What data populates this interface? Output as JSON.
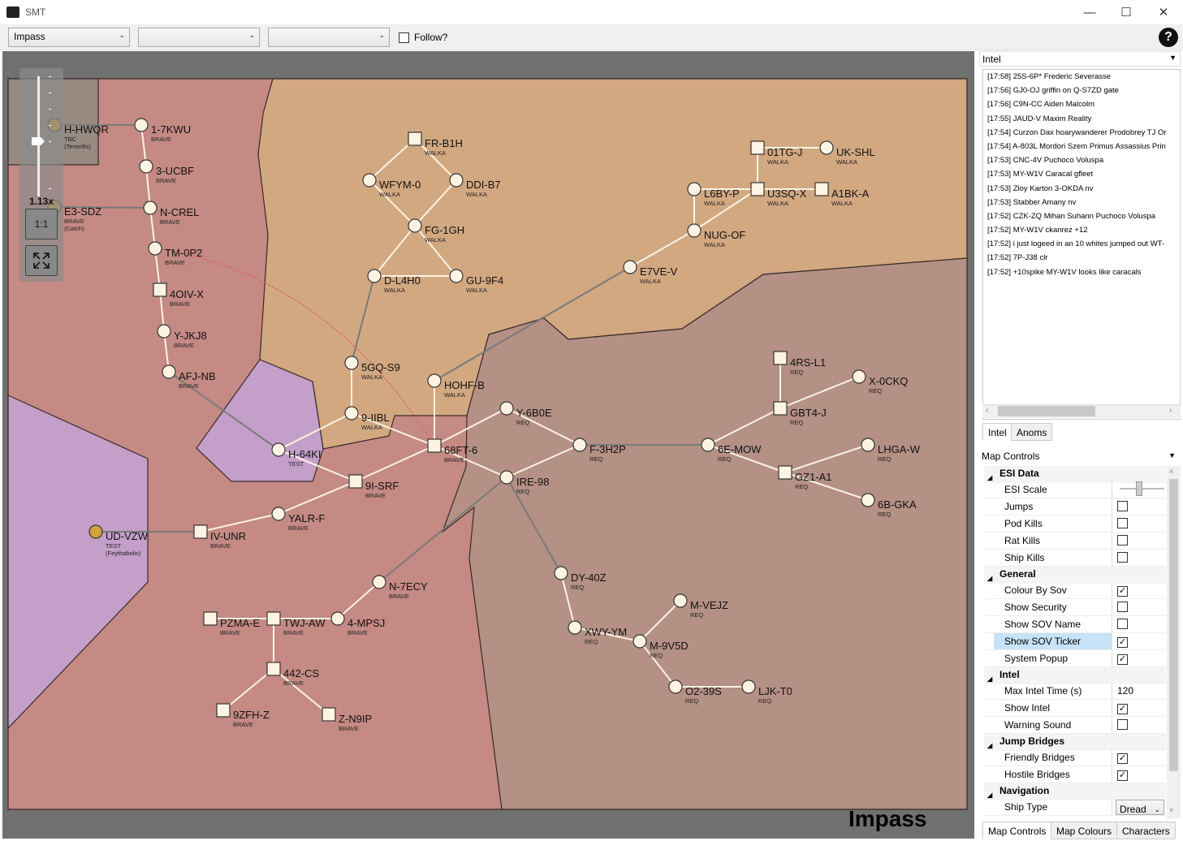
{
  "window": {
    "title": "SMT"
  },
  "toolbar": {
    "region_select": "Impass",
    "select_2": "",
    "select_3": "",
    "follow_label": "Follow?",
    "follow_checked": false,
    "help_label": "?"
  },
  "map": {
    "region_name": "Impass",
    "zoom_label": "1.13x",
    "reset_zoom_label": "1:1",
    "colors": {
      "brave": "#c48a83",
      "walka": "#d2a881",
      "req": "#b49085",
      "test": "#c49fc9",
      "tbc": "#978a81",
      "border": "#3a2a2a",
      "node_fill": "#fdf3e3",
      "jb_line": "#e06060"
    },
    "systems": [
      {
        "name": "H-HWQR",
        "sov": "TBC",
        "sub": "(Tenerifis)",
        "shape": "circle",
        "highlight": true
      },
      {
        "name": "1-7KWU",
        "sov": "BRAVE",
        "shape": "circle"
      },
      {
        "name": "3-UCBF",
        "sov": "BRAVE",
        "shape": "circle"
      },
      {
        "name": "E3-SDZ",
        "sov": "BRAVE",
        "sub": "(Catch)",
        "shape": "circle",
        "highlight": true
      },
      {
        "name": "N-CREL",
        "sov": "BRAVE",
        "shape": "circle"
      },
      {
        "name": "TM-0P2",
        "sov": "BRAVE",
        "shape": "circle"
      },
      {
        "name": "4OIV-X",
        "sov": "BRAVE",
        "shape": "square"
      },
      {
        "name": "Y-JKJ8",
        "sov": "BRAVE",
        "shape": "circle"
      },
      {
        "name": "AFJ-NB",
        "sov": "BRAVE",
        "shape": "circle"
      },
      {
        "name": "H-64KI",
        "sov": "TEST",
        "shape": "circle"
      },
      {
        "name": "FR-B1H",
        "sov": "WALKA",
        "shape": "square"
      },
      {
        "name": "WFYM-0",
        "sov": "WALKA",
        "shape": "circle"
      },
      {
        "name": "DDI-B7",
        "sov": "WALKA",
        "shape": "circle"
      },
      {
        "name": "FG-1GH",
        "sov": "WALKA",
        "shape": "circle"
      },
      {
        "name": "D-L4H0",
        "sov": "WALKA",
        "shape": "circle"
      },
      {
        "name": "GU-9F4",
        "sov": "WALKA",
        "shape": "circle"
      },
      {
        "name": "5GQ-S9",
        "sov": "WALKA",
        "shape": "circle"
      },
      {
        "name": "9-IIBL",
        "sov": "WALKA",
        "shape": "circle"
      },
      {
        "name": "HOHF-B",
        "sov": "WALKA",
        "shape": "circle"
      },
      {
        "name": "68FT-6",
        "sov": "BRAVE",
        "shape": "square"
      },
      {
        "name": "9I-SRF",
        "sov": "BRAVE",
        "shape": "square"
      },
      {
        "name": "YALR-F",
        "sov": "BRAVE",
        "shape": "circle"
      },
      {
        "name": "IV-UNR",
        "sov": "BRAVE",
        "shape": "square"
      },
      {
        "name": "UD-VZW",
        "sov": "TEST",
        "sub": "(Feythabolis)",
        "shape": "circle",
        "highlight": true
      },
      {
        "name": "N-7ECY",
        "sov": "BRAVE",
        "shape": "circle"
      },
      {
        "name": "4-MPSJ",
        "sov": "BRAVE",
        "shape": "circle"
      },
      {
        "name": "TWJ-AW",
        "sov": "BRAVE",
        "shape": "square"
      },
      {
        "name": "PZMA-E",
        "sov": "BRAVE",
        "shape": "square"
      },
      {
        "name": "442-CS",
        "sov": "BRAVE",
        "shape": "square"
      },
      {
        "name": "9ZFH-Z",
        "sov": "BRAVE",
        "shape": "square"
      },
      {
        "name": "Z-N9IP",
        "sov": "BRAVE",
        "shape": "square"
      },
      {
        "name": "Y-6B0E",
        "sov": "REQ",
        "shape": "circle"
      },
      {
        "name": "F-3H2P",
        "sov": "REQ",
        "shape": "circle"
      },
      {
        "name": "IRE-98",
        "sov": "REQ",
        "shape": "circle"
      },
      {
        "name": "DY-40Z",
        "sov": "REQ",
        "shape": "circle"
      },
      {
        "name": "XWY-YM",
        "sov": "REQ",
        "shape": "circle"
      },
      {
        "name": "M-9V5D",
        "sov": "REQ",
        "shape": "circle"
      },
      {
        "name": "M-VEJZ",
        "sov": "REQ",
        "shape": "circle"
      },
      {
        "name": "O2-39S",
        "sov": "REQ",
        "shape": "circle"
      },
      {
        "name": "LJK-T0",
        "sov": "REQ",
        "shape": "circle"
      },
      {
        "name": "6E-MOW",
        "sov": "REQ",
        "shape": "circle"
      },
      {
        "name": "GZ1-A1",
        "sov": "REQ",
        "shape": "square"
      },
      {
        "name": "LHGA-W",
        "sov": "REQ",
        "shape": "circle"
      },
      {
        "name": "6B-GKA",
        "sov": "REQ",
        "shape": "circle"
      },
      {
        "name": "GBT4-J",
        "sov": "REQ",
        "shape": "square"
      },
      {
        "name": "4RS-L1",
        "sov": "REQ",
        "shape": "square"
      },
      {
        "name": "X-0CKQ",
        "sov": "REQ",
        "shape": "circle"
      },
      {
        "name": "E7VE-V",
        "sov": "WALKA",
        "shape": "circle"
      },
      {
        "name": "NUG-OF",
        "sov": "WALKA",
        "shape": "circle"
      },
      {
        "name": "L6BY-P",
        "sov": "WALKA",
        "shape": "circle"
      },
      {
        "name": "U3SQ-X",
        "sov": "WALKA",
        "shape": "square"
      },
      {
        "name": "A1BK-A",
        "sov": "WALKA",
        "shape": "square"
      },
      {
        "name": "01TG-J",
        "sov": "WALKA",
        "shape": "square"
      },
      {
        "name": "UK-SHL",
        "sov": "WALKA",
        "shape": "circle"
      }
    ],
    "jumps": [
      [
        "H-HWQR",
        "1-7KWU",
        "x"
      ],
      [
        "1-7KWU",
        "3-UCBF",
        ""
      ],
      [
        "3-UCBF",
        "N-CREL",
        ""
      ],
      [
        "E3-SDZ",
        "N-CREL",
        "x"
      ],
      [
        "N-CREL",
        "TM-0P2",
        ""
      ],
      [
        "TM-0P2",
        "4OIV-X",
        ""
      ],
      [
        "4OIV-X",
        "Y-JKJ8",
        ""
      ],
      [
        "Y-JKJ8",
        "AFJ-NB",
        ""
      ],
      [
        "AFJ-NB",
        "H-64KI",
        "x"
      ],
      [
        "H-64KI",
        "9-IIBL",
        ""
      ],
      [
        "H-64KI",
        "9I-SRF",
        ""
      ],
      [
        "9I-SRF",
        "68FT-6",
        ""
      ],
      [
        "9I-SRF",
        "YALR-F",
        ""
      ],
      [
        "YALR-F",
        "IV-UNR",
        ""
      ],
      [
        "IV-UNR",
        "UD-VZW",
        "x"
      ],
      [
        "FR-B1H",
        "WFYM-0",
        ""
      ],
      [
        "FR-B1H",
        "DDI-B7",
        ""
      ],
      [
        "WFYM-0",
        "FG-1GH",
        ""
      ],
      [
        "DDI-B7",
        "FG-1GH",
        ""
      ],
      [
        "FG-1GH",
        "D-L4H0",
        ""
      ],
      [
        "FG-1GH",
        "GU-9F4",
        ""
      ],
      [
        "D-L4H0",
        "GU-9F4",
        ""
      ],
      [
        "D-L4H0",
        "5GQ-S9",
        "x"
      ],
      [
        "5GQ-S9",
        "9-IIBL",
        ""
      ],
      [
        "9-IIBL",
        "68FT-6",
        ""
      ],
      [
        "HOHF-B",
        "68FT-6",
        ""
      ],
      [
        "HOHF-B",
        "E7VE-V",
        "x"
      ],
      [
        "68FT-6",
        "Y-6B0E",
        ""
      ],
      [
        "68FT-6",
        "IRE-98",
        ""
      ],
      [
        "Y-6B0E",
        "F-3H2P",
        ""
      ],
      [
        "IRE-98",
        "F-3H2P",
        ""
      ],
      [
        "IRE-98",
        "N-7ECY",
        "x"
      ],
      [
        "IRE-98",
        "DY-40Z",
        "x"
      ],
      [
        "DY-40Z",
        "XWY-YM",
        ""
      ],
      [
        "XWY-YM",
        "M-9V5D",
        ""
      ],
      [
        "M-9V5D",
        "M-VEJZ",
        ""
      ],
      [
        "M-9V5D",
        "O2-39S",
        ""
      ],
      [
        "O2-39S",
        "LJK-T0",
        ""
      ],
      [
        "F-3H2P",
        "6E-MOW",
        "x"
      ],
      [
        "6E-MOW",
        "GBT4-J",
        ""
      ],
      [
        "6E-MOW",
        "GZ1-A1",
        ""
      ],
      [
        "GZ1-A1",
        "LHGA-W",
        ""
      ],
      [
        "GZ1-A1",
        "6B-GKA",
        ""
      ],
      [
        "GBT4-J",
        "4RS-L1",
        ""
      ],
      [
        "GBT4-J",
        "X-0CKQ",
        ""
      ],
      [
        "N-7ECY",
        "4-MPSJ",
        ""
      ],
      [
        "4-MPSJ",
        "TWJ-AW",
        ""
      ],
      [
        "TWJ-AW",
        "PZMA-E",
        ""
      ],
      [
        "TWJ-AW",
        "442-CS",
        ""
      ],
      [
        "442-CS",
        "9ZFH-Z",
        ""
      ],
      [
        "442-CS",
        "Z-N9IP",
        ""
      ],
      [
        "E7VE-V",
        "NUG-OF",
        ""
      ],
      [
        "NUG-OF",
        "L6BY-P",
        ""
      ],
      [
        "NUG-OF",
        "U3SQ-X",
        ""
      ],
      [
        "L6BY-P",
        "U3SQ-X",
        ""
      ],
      [
        "U3SQ-X",
        "A1BK-A",
        ""
      ],
      [
        "U3SQ-X",
        "01TG-J",
        ""
      ],
      [
        "01TG-J",
        "UK-SHL",
        ""
      ]
    ],
    "jump_bridges": [
      [
        "TM-0P2",
        "68FT-6"
      ]
    ]
  },
  "intel": {
    "header": "Intel",
    "entries": [
      {
        "time": "[17:58]",
        "text": "25S-6P*  Frederic Severasse"
      },
      {
        "time": "[17:56]",
        "text": "GJ0-OJ griffin on  Q-S7ZD gate"
      },
      {
        "time": "[17:56]",
        "text": "C9N-CC  Aiden Malcolm"
      },
      {
        "time": "[17:55]",
        "text": "JAUD-V  Maxim Reality"
      },
      {
        "time": "[17:54]",
        "text": "Curzon Dax  hoarywanderer  Prodobrey  TJ Or"
      },
      {
        "time": "[17:54]",
        "text": "A-803L  Mordori Szem  Primus Assassius  Prin"
      },
      {
        "time": "[17:53]",
        "text": "CNC-4V  Puchoco Voluspa"
      },
      {
        "time": "[17:53]",
        "text": "MY-W1V Caracal gfleet"
      },
      {
        "time": "[17:53]",
        "text": "Zloy Karton  3-OKDA nv"
      },
      {
        "time": "[17:53]",
        "text": "Stabber Amany nv"
      },
      {
        "time": "[17:52]",
        "text": "CZK-ZQ  Mihan Suhann  Puchoco Voluspa"
      },
      {
        "time": "[17:52]",
        "text": "MY-W1V  ckanrez +12"
      },
      {
        "time": "[17:52]",
        "text": "i just logeed in an 10 whites jumped out  WT-"
      },
      {
        "time": "[17:52]",
        "text": "7P-J38 clr"
      },
      {
        "time": "[17:52]",
        "text": "+10spike  MY-W1V looks like caracals"
      }
    ],
    "tabs": [
      "Intel",
      "Anoms"
    ]
  },
  "map_controls": {
    "header": "Map Controls",
    "sections": [
      {
        "title": "ESI Data",
        "props": [
          {
            "name": "ESI Scale",
            "type": "slider"
          },
          {
            "name": "Jumps",
            "type": "check",
            "value": false
          },
          {
            "name": "Pod Kills",
            "type": "check",
            "value": false
          },
          {
            "name": "Rat Kills",
            "type": "check",
            "value": false
          },
          {
            "name": "Ship Kills",
            "type": "check",
            "value": false
          }
        ]
      },
      {
        "title": "General",
        "props": [
          {
            "name": "Colour By Sov",
            "type": "check",
            "value": true
          },
          {
            "name": "Show Security",
            "type": "check",
            "value": false
          },
          {
            "name": "Show SOV Name",
            "type": "check",
            "value": false
          },
          {
            "name": "Show SOV Ticker",
            "type": "check",
            "value": true,
            "selected": true
          },
          {
            "name": "System Popup",
            "type": "check",
            "value": true
          }
        ]
      },
      {
        "title": "Intel",
        "props": [
          {
            "name": "Max Intel Time (s)",
            "type": "text",
            "value": "120"
          },
          {
            "name": "Show Intel",
            "type": "check",
            "value": true
          },
          {
            "name": "Warning Sound",
            "type": "check",
            "value": false
          }
        ]
      },
      {
        "title": "Jump Bridges",
        "props": [
          {
            "name": "Friendly Bridges",
            "type": "check",
            "value": true
          },
          {
            "name": "Hostile Bridges",
            "type": "check",
            "value": true
          }
        ]
      },
      {
        "title": "Navigation",
        "props": [
          {
            "name": "Ship Type",
            "type": "select",
            "value": "Dread"
          }
        ]
      }
    ],
    "tabs": [
      "Map Controls",
      "Map Colours",
      "Characters"
    ]
  }
}
